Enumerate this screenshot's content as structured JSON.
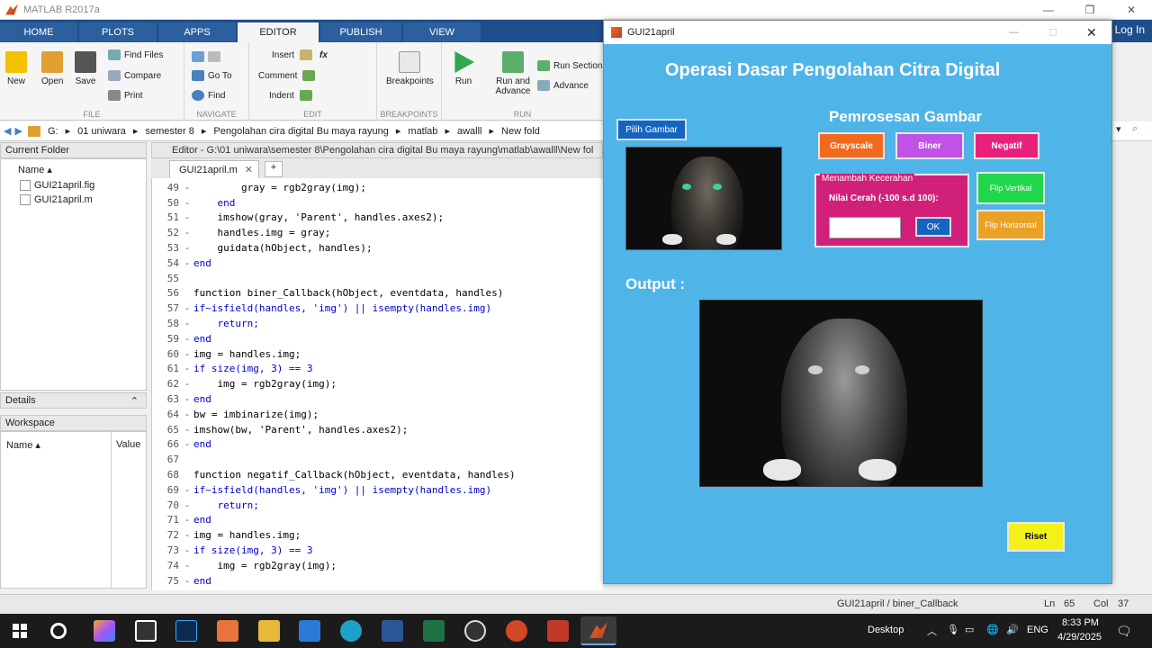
{
  "matlab": {
    "title": "MATLAB R2017a",
    "tabs": [
      "HOME",
      "PLOTS",
      "APPS",
      "EDITOR",
      "PUBLISH",
      "VIEW"
    ],
    "login": "Log In",
    "ribbon": {
      "file": {
        "label": "FILE",
        "new": "New",
        "open": "Open",
        "save": "Save",
        "find_files": "Find Files",
        "compare": "Compare",
        "print": "Print"
      },
      "navigate": {
        "label": "NAVIGATE",
        "go_to": "Go To",
        "find": "Find"
      },
      "edit": {
        "label": "EDIT",
        "insert": "Insert",
        "comment": "Comment",
        "indent": "Indent",
        "fx": "fx"
      },
      "breakpoints": {
        "label": "BREAKPOINTS",
        "breakpoints": "Breakpoints"
      },
      "run": {
        "label": "RUN",
        "run": "Run",
        "run_and_advance": "Run and Advance",
        "run_section": "Run Section",
        "advance": "Advance"
      }
    },
    "address": [
      "G:",
      "01 uniwara",
      "semester 8",
      "Pengolahan cira digital Bu maya rayung",
      "matlab",
      "awalll",
      "New fold"
    ],
    "current_folder": {
      "title": "Current Folder",
      "col_name": "Name ▴",
      "files": [
        "GUI21april.fig",
        "GUI21april.m"
      ]
    },
    "details": {
      "title": "Details"
    },
    "workspace": {
      "title": "Workspace",
      "col_name": "Name ▴",
      "col_value": "Value"
    },
    "editor": {
      "title": "Editor - G:\\01 uniwara\\semester 8\\Pengolahan cira digital Bu maya rayung\\matlab\\awalll\\New fol",
      "tab": "GUI21april.m",
      "lines": [
        {
          "n": "49",
          "d": "-",
          "c": "        gray = rgb2gray(img);"
        },
        {
          "n": "50",
          "d": "-",
          "c": "    end"
        },
        {
          "n": "51",
          "d": "-",
          "c": "    imshow(gray, 'Parent', handles.axes2);"
        },
        {
          "n": "52",
          "d": "-",
          "c": "    handles.img = gray;"
        },
        {
          "n": "53",
          "d": "-",
          "c": "    guidata(hObject, handles);"
        },
        {
          "n": "54",
          "d": "-",
          "c": "end"
        },
        {
          "n": "55",
          "d": "",
          "c": ""
        },
        {
          "n": "56",
          "d": "",
          "c": "function biner_Callback(hObject, eventdata, handles)"
        },
        {
          "n": "57",
          "d": "-",
          "c": "if~isfield(handles, 'img') || isempty(handles.img)"
        },
        {
          "n": "58",
          "d": "-",
          "c": "    return;"
        },
        {
          "n": "59",
          "d": "-",
          "c": "end"
        },
        {
          "n": "60",
          "d": "-",
          "c": "img = handles.img;"
        },
        {
          "n": "61",
          "d": "-",
          "c": "if size(img, 3) == 3"
        },
        {
          "n": "62",
          "d": "-",
          "c": "    img = rgb2gray(img);"
        },
        {
          "n": "63",
          "d": "-",
          "c": "end"
        },
        {
          "n": "64",
          "d": "-",
          "c": "bw = imbinarize(img);"
        },
        {
          "n": "65",
          "d": "-",
          "c": "imshow(bw, 'Parent', handles.axes2);"
        },
        {
          "n": "66",
          "d": "-",
          "c": "end"
        },
        {
          "n": "67",
          "d": "",
          "c": ""
        },
        {
          "n": "68",
          "d": "",
          "c": "function negatif_Callback(hObject, eventdata, handles)"
        },
        {
          "n": "69",
          "d": "-",
          "c": "if~isfield(handles, 'img') || isempty(handles.img)"
        },
        {
          "n": "70",
          "d": "-",
          "c": "    return;"
        },
        {
          "n": "71",
          "d": "-",
          "c": "end"
        },
        {
          "n": "72",
          "d": "-",
          "c": "img = handles.img;"
        },
        {
          "n": "73",
          "d": "-",
          "c": "if size(img, 3) == 3"
        },
        {
          "n": "74",
          "d": "-",
          "c": "    img = rgb2gray(img);"
        },
        {
          "n": "75",
          "d": "-",
          "c": "end"
        }
      ]
    },
    "status": {
      "func": "GUI21april / biner_Callback",
      "ln_label": "Ln",
      "ln": "65",
      "col_label": "Col",
      "col": "37"
    }
  },
  "gui": {
    "window_title": "GUI21april",
    "heading": "Operasi Dasar  Pengolahan Citra Digital",
    "pilih_gambar": "Pilih Gambar",
    "pemrosesan": "Pemrosesan Gambar",
    "grayscale": "Grayscale",
    "biner": "Biner",
    "negatif": "Negatif",
    "panel_title": "Menambah Kecerahan",
    "nilai_label": "Nilai Cerah (-100 s.d 100):",
    "brightness_value": "",
    "ok": "OK",
    "flip_vertikal": "Flip Vertikal",
    "flip_horizontal": "Flip Horizontal",
    "output_label": "Output :",
    "riset": "Riset",
    "colors": {
      "bg": "#4fb4e8",
      "grayscale": "#f26a1b",
      "biner": "#c052e8",
      "negatif": "#e8207c",
      "flip_v": "#21d64a",
      "flip_h": "#eaa226",
      "riset": "#f2f21a",
      "panel": "#d0207a"
    }
  },
  "taskbar": {
    "desktop": "Desktop",
    "lang": "ENG",
    "time": "8:33 PM",
    "date": "4/29/2025"
  }
}
